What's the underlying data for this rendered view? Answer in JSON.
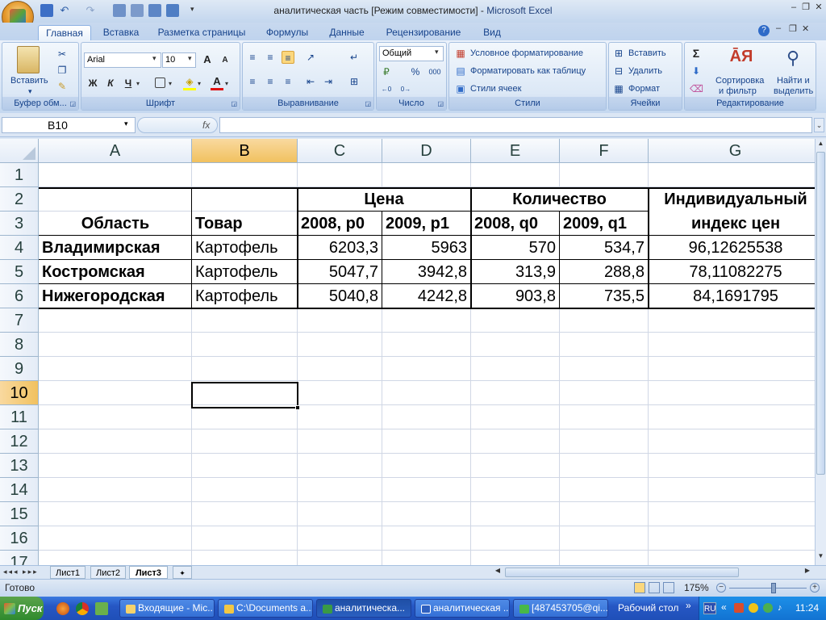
{
  "window": {
    "title_doc": "аналитическая часть  [Режим совместимости]",
    "title_sep": " - ",
    "title_app": "Microsoft Excel"
  },
  "ribbon_tabs": [
    "Главная",
    "Вставка",
    "Разметка страницы",
    "Формулы",
    "Данные",
    "Рецензирование",
    "Вид"
  ],
  "ribbon": {
    "clipboard": {
      "paste": "Вставить",
      "title": "Буфер обм..."
    },
    "font": {
      "name": "Arial",
      "size": "10",
      "bold": "Ж",
      "italic": "К",
      "underline": "Ч",
      "grow": "A",
      "shrink": "A",
      "color_letter": "A",
      "title": "Шрифт"
    },
    "alignment": {
      "title": "Выравнивание"
    },
    "number": {
      "format": "Общий",
      "percent": "%",
      "thousands": "000",
      "title": "Число"
    },
    "styles": {
      "cond": "Условное форматирование",
      "table": "Форматировать как таблицу",
      "cell": "Стили ячеек",
      "title": "Стили"
    },
    "cells": {
      "insert": "Вставить",
      "delete": "Удалить",
      "format": "Формат",
      "title": "Ячейки"
    },
    "editing": {
      "sum": "Σ",
      "sort_l1": "Сортировка",
      "sort_l2": "и фильтр",
      "find_l1": "Найти и",
      "find_l2": "выделить",
      "title": "Редактирование"
    }
  },
  "formula_bar": {
    "name_box": "B10",
    "fx": "fx",
    "value": ""
  },
  "columns": [
    "A",
    "B",
    "C",
    "D",
    "E",
    "F",
    "G"
  ],
  "rows": [
    "1",
    "2",
    "3",
    "4",
    "5",
    "6",
    "7",
    "8",
    "9",
    "10",
    "11",
    "12",
    "13",
    "14",
    "15",
    "16",
    "17"
  ],
  "table": {
    "header_price": "Цена",
    "header_qty": "Количество",
    "header_index_l1": "Индивидуальный",
    "header_index_l2": "индекс цен",
    "col_region": "Область",
    "col_product": "Товар",
    "col_p0": "2008, р0",
    "col_p1": "2009,  р1",
    "col_q0": "2008,  q0",
    "col_q1": "2009,  q1",
    "data": [
      {
        "region": "Владимирская",
        "product": "Картофель",
        "p0": "6203,3",
        "p1": "5963",
        "q0": "570",
        "q1": "534,7",
        "index": "96,12625538"
      },
      {
        "region": "Костромская",
        "product": "Картофель",
        "p0": "5047,7",
        "p1": "3942,8",
        "q0": "313,9",
        "q1": "288,8",
        "index": "78,11082275"
      },
      {
        "region": "Нижегородская",
        "product": "Картофель",
        "p0": "5040,8",
        "p1": "4242,8",
        "q0": "903,8",
        "q1": "735,5",
        "index": "84,1691795"
      }
    ]
  },
  "sheet_tabs": [
    "Лист1",
    "Лист2",
    "Лист3"
  ],
  "status": {
    "ready": "Готово",
    "zoom": "175%"
  },
  "taskbar": {
    "start": "Пуск",
    "tasks": [
      "Входящие - Mic...",
      "C:\\Documents a...",
      "аналитическа...",
      "аналитическая ...",
      "[487453705@qi..."
    ],
    "desktop": "Рабочий стол",
    "lang": "RU",
    "clock": "11:24"
  },
  "colors": {
    "accent": "#15428b",
    "selection_header": "#f1c15f",
    "taskbar": "#2657c4"
  }
}
